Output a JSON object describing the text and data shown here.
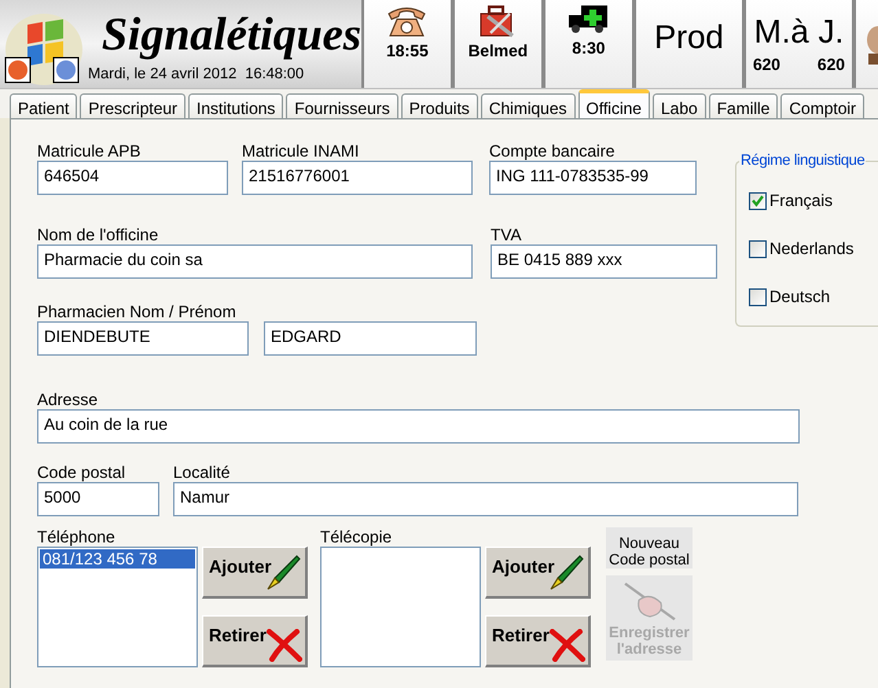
{
  "header": {
    "title": "Signalétiques",
    "date": "Mardi, le 24 avril 2012  16:48:00"
  },
  "toolbar": [
    {
      "kind": "phone",
      "label": "18:55"
    },
    {
      "kind": "toolbox",
      "label": "Belmed"
    },
    {
      "kind": "ambulance",
      "label": "8:30"
    },
    {
      "kind": "text",
      "label": "Prod"
    },
    {
      "kind": "update",
      "label": "M.à J.",
      "counts": [
        "620",
        "620"
      ]
    },
    {
      "kind": "cut"
    }
  ],
  "tabs": [
    {
      "label": "Patient",
      "selected": false
    },
    {
      "label": "Prescripteur",
      "selected": false
    },
    {
      "label": "Institutions",
      "selected": false
    },
    {
      "label": "Fournisseurs",
      "selected": false
    },
    {
      "label": "Produits",
      "selected": false
    },
    {
      "label": "Chimiques",
      "selected": false
    },
    {
      "label": "Officine",
      "selected": true
    },
    {
      "label": "Labo",
      "selected": false
    },
    {
      "label": "Famille",
      "selected": false
    },
    {
      "label": "Comptoir",
      "selected": false
    }
  ],
  "form": {
    "matricule_apb": {
      "label": "Matricule APB",
      "value": "646504"
    },
    "matricule_inami": {
      "label": "Matricule INAMI",
      "value": "21516776001"
    },
    "compte_bancaire": {
      "label": "Compte bancaire",
      "value": "ING 111-0783535-99"
    },
    "nom_officine": {
      "label": "Nom de l'officine",
      "value": "Pharmacie du coin sa"
    },
    "tva": {
      "label": "TVA",
      "value": "BE 0415 889 xxx"
    },
    "pharmacien": {
      "label": "Pharmacien Nom / Prénom",
      "values": [
        "DIENDEBUTE",
        "EDGARD"
      ]
    },
    "adresse": {
      "label": "Adresse",
      "value": "Au coin de la rue"
    },
    "code_postal": {
      "label": "Code postal",
      "value": "5000"
    },
    "localite": {
      "label": "Localité",
      "value": "Namur"
    }
  },
  "language_group": {
    "title": "Régime linguistique",
    "options": [
      {
        "label": "Français",
        "checked": true
      },
      {
        "label": "Nederlands",
        "checked": false
      },
      {
        "label": "Deutsch",
        "checked": false
      }
    ]
  },
  "lists": [
    {
      "label": "Téléphone",
      "items": [
        {
          "text": "081/123 456 78",
          "selected": true
        }
      ],
      "buttons": [
        {
          "kind": "add",
          "label": "Ajouter"
        },
        {
          "kind": "remove",
          "label": "Retirer"
        }
      ]
    },
    {
      "label": "Télécopie",
      "buttons": [
        {
          "kind": "add",
          "label": "Ajouter"
        },
        {
          "kind": "remove",
          "label": "Retirer"
        }
      ]
    }
  ],
  "side_buttons": [
    {
      "kind": "text",
      "label": "Nouveau Code postal",
      "disabled": false
    },
    {
      "kind": "signature",
      "label": "Enregistrer l'adresse",
      "disabled": true
    }
  ]
}
